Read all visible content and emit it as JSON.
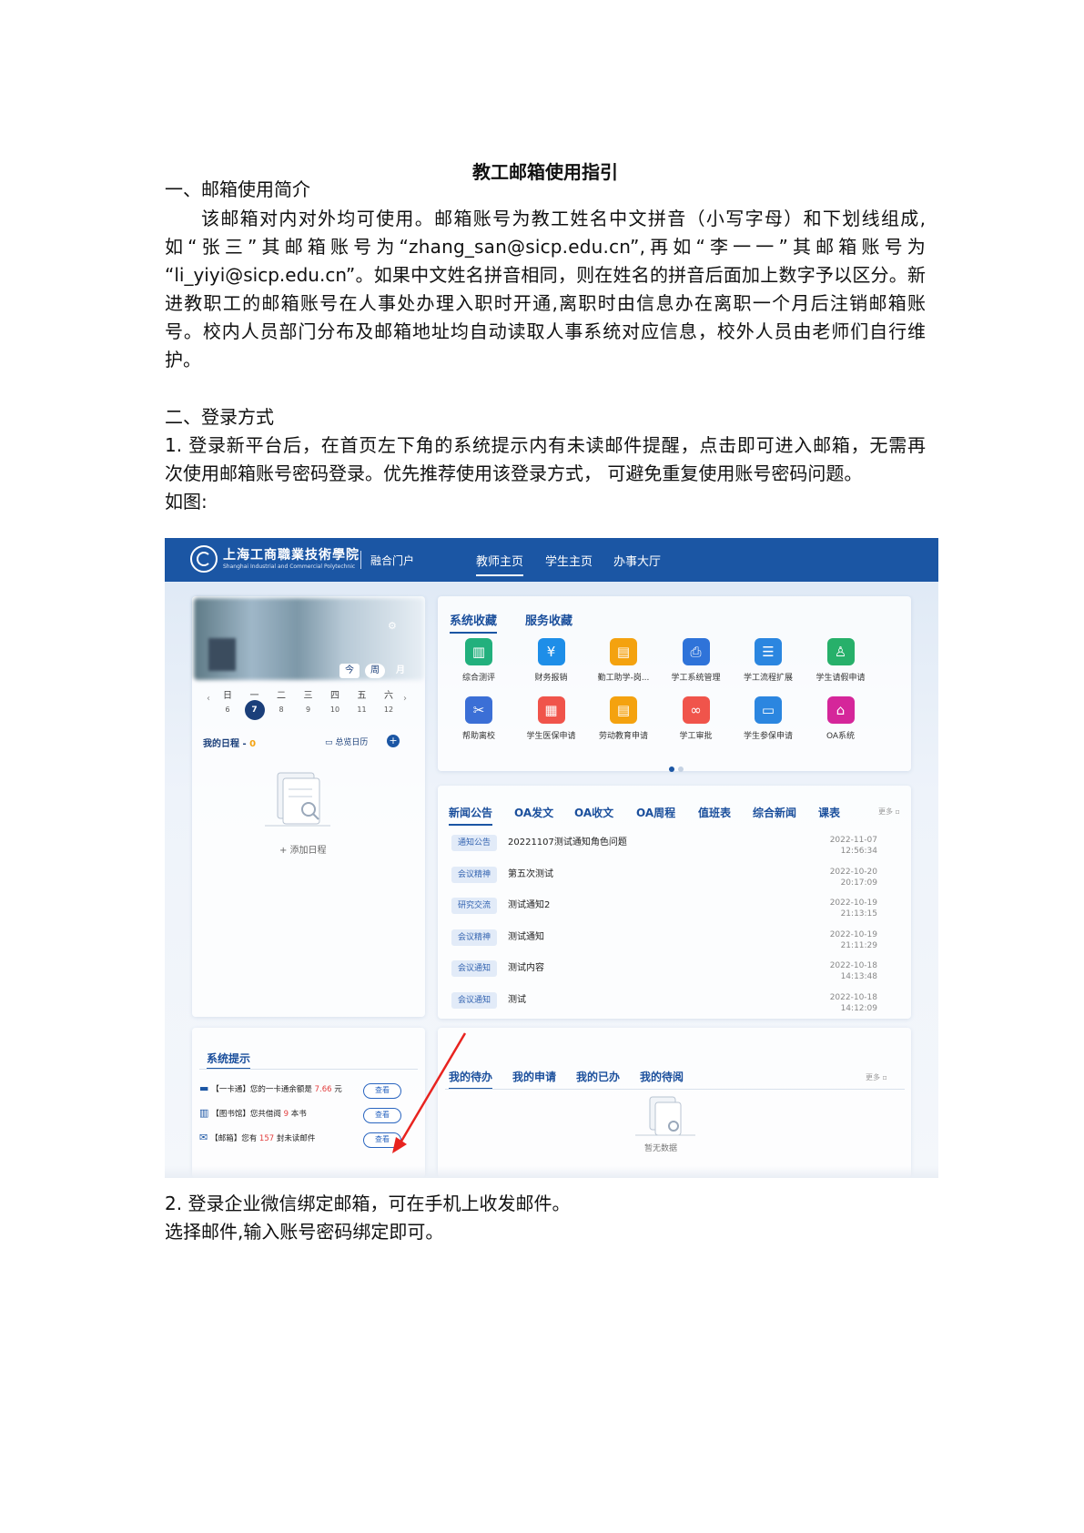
{
  "document": {
    "title": "教工邮箱使用指引",
    "section1_heading": "一、邮箱使用简介",
    "section1_lines": [
      "该邮箱对内对外均可使用。邮箱账号为教工姓名中文拼音（小写字母）和下划线组成,",
      "如“张三”其邮箱账号为“zhang_san@sicp.edu.cn”,再如“李一一”其邮箱账号为",
      "“li_yiyi@sicp.edu.cn”。如果中文姓名拼音相同，则在姓名的拼音后面加上数字予以区分。新",
      "进教职工的邮箱账号在人事处办理入职时开通,离职时由信息办在离职一个月后注销邮箱账",
      "号。校内人员部门分布及邮箱地址均自动读取人事系统对应信息，校外人员由老师们自行维",
      "护。"
    ],
    "section2_heading": "二、登录方式",
    "section2_lines": [
      "1. 登录新平台后，在首页左下角的系统提示内有未读邮件提醒，点击即可进入邮箱，无需再",
      "次使用邮箱账号密码登录。优先推荐使用该登录方式， 可避免重复使用账号密码问题。",
      "如图:"
    ],
    "after_lines": [
      "2.  登录企业微信绑定邮箱，可在手机上收发邮件。",
      "选择邮件,输入账号密码绑定即可。"
    ]
  },
  "portal": {
    "logo_cn": "上海工商職業技術學院",
    "logo_en": "Shanghai Industrial and Commercial Polytechnic",
    "portal_name": "融合门户",
    "nav": [
      "教师主页",
      "学生主页",
      "办事大厅"
    ],
    "calendar": {
      "view_buttons": [
        "今",
        "周",
        "月"
      ],
      "weekdays": [
        "日",
        "一",
        "二",
        "三",
        "四",
        "五",
        "六"
      ],
      "days": [
        "6",
        "7",
        "8",
        "9",
        "10",
        "11",
        "12"
      ],
      "today": "7",
      "schedule_label": "我的日程 -",
      "schedule_count": "0",
      "schedule_link": "总览日历",
      "add_schedule": "+ 添加日程"
    },
    "fav_tabs": [
      "系统收藏",
      "服务收藏"
    ],
    "apps": [
      {
        "label": "综合测评",
        "color": "#22b07d",
        "icon": "chart-icon"
      },
      {
        "label": "财务报销",
        "color": "#1e8ee8",
        "icon": "yen-icon"
      },
      {
        "label": "勤工助学-岗...",
        "color": "#f4a20f",
        "icon": "id-card-icon"
      },
      {
        "label": "学工系统管理",
        "color": "#2f73d9",
        "icon": "print-icon"
      },
      {
        "label": "学工流程扩展",
        "color": "#2b86e0",
        "icon": "list-icon"
      },
      {
        "label": "学生请假申请",
        "color": "#27b06a",
        "icon": "person-icon"
      },
      {
        "label": "帮助离校",
        "color": "#3b6fd6",
        "icon": "tools-icon"
      },
      {
        "label": "学生医保申请",
        "color": "#f0544b",
        "icon": "building-icon"
      },
      {
        "label": "劳动教育申请",
        "color": "#f4a20f",
        "icon": "id-card-icon"
      },
      {
        "label": "学工审批",
        "color": "#f0544b",
        "icon": "flow-icon"
      },
      {
        "label": "学生参保申请",
        "color": "#2b86e0",
        "icon": "card-icon"
      },
      {
        "label": "OA系统",
        "color": "#d5269a",
        "icon": "bank-icon"
      }
    ],
    "news_tabs": [
      "新闻公告",
      "OA发文",
      "OA收文",
      "OA周程",
      "值班表",
      "综合新闻",
      "课表"
    ],
    "more": "更多",
    "news": [
      {
        "tag": "通知公告",
        "title": "20221107测试通知角色问题",
        "date": "2022-11-07",
        "time": "12:56:34"
      },
      {
        "tag": "会议精神",
        "title": "第五次测试",
        "date": "2022-10-20",
        "time": "20:17:09"
      },
      {
        "tag": "研究交流",
        "title": "测试通知2",
        "date": "2022-10-19",
        "time": "21:13:15"
      },
      {
        "tag": "会议精神",
        "title": "测试通知",
        "date": "2022-10-19",
        "time": "21:11:29"
      },
      {
        "tag": "会议通知",
        "title": "测试内容",
        "date": "2022-10-18",
        "time": "14:13:48"
      },
      {
        "tag": "会议通知",
        "title": "测试",
        "date": "2022-10-18",
        "time": "14:12:09"
      }
    ],
    "system_tips_title": "系统提示",
    "system_tips": [
      {
        "prefix": "【一卡通】您的一卡通余额是",
        "value": "7.66",
        "suffix": "元",
        "button": "查看"
      },
      {
        "prefix": "【图书馆】您共借阅",
        "value": "9",
        "suffix": "本书",
        "button": "查看"
      },
      {
        "prefix": "【邮箱】您有",
        "value": "157",
        "suffix": "封未读邮件",
        "button": "查看"
      }
    ],
    "task_tabs": [
      "我的待办",
      "我的申请",
      "我的已办",
      "我的待阅"
    ],
    "no_data": "暂无数据"
  }
}
